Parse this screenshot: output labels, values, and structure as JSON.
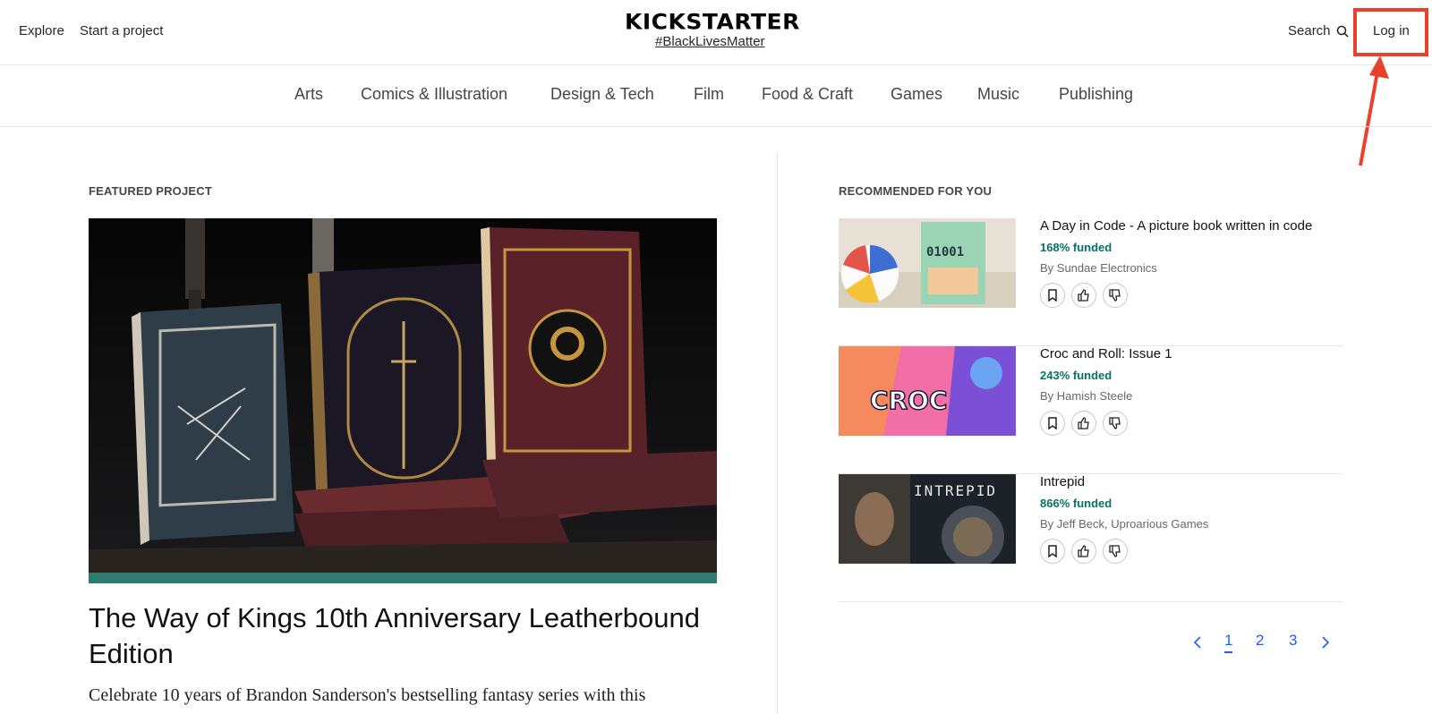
{
  "header": {
    "explore": "Explore",
    "start_project": "Start a project",
    "logo": "KICKSTARTER",
    "hashtag": "#BlackLivesMatter",
    "search": "Search",
    "login": "Log in"
  },
  "categories": [
    "Arts",
    "Comics & Illustration",
    "Design & Tech",
    "Film",
    "Food & Craft",
    "Games",
    "Music",
    "Publishing"
  ],
  "featured": {
    "label": "FEATURED PROJECT",
    "title": "The Way of Kings 10th Anniversary Leatherbound Edition",
    "description": "Celebrate 10 years of Brandon Sanderson's bestselling fantasy series with this"
  },
  "recommended": {
    "label": "RECOMMENDED FOR YOU",
    "items": [
      {
        "title": "A Day in Code - A picture book written in code",
        "funded": "168% funded",
        "by": "By Sundae Electronics"
      },
      {
        "title": "Croc and Roll: Issue 1",
        "funded": "243% funded",
        "by": "By Hamish Steele"
      },
      {
        "title": "Intrepid",
        "funded": "866% funded",
        "by": "By Jeff Beck, Uproarious Games"
      }
    ]
  },
  "thumb_text": {
    "code": "01001",
    "croc": "CROC",
    "intrepid": "INTREPID"
  },
  "pagination": {
    "pages": [
      "1",
      "2",
      "3"
    ],
    "active": "1"
  },
  "colors": {
    "funded_green": "#037362",
    "link_blue": "#1e5cff",
    "annotation_red": "#e8412c"
  }
}
